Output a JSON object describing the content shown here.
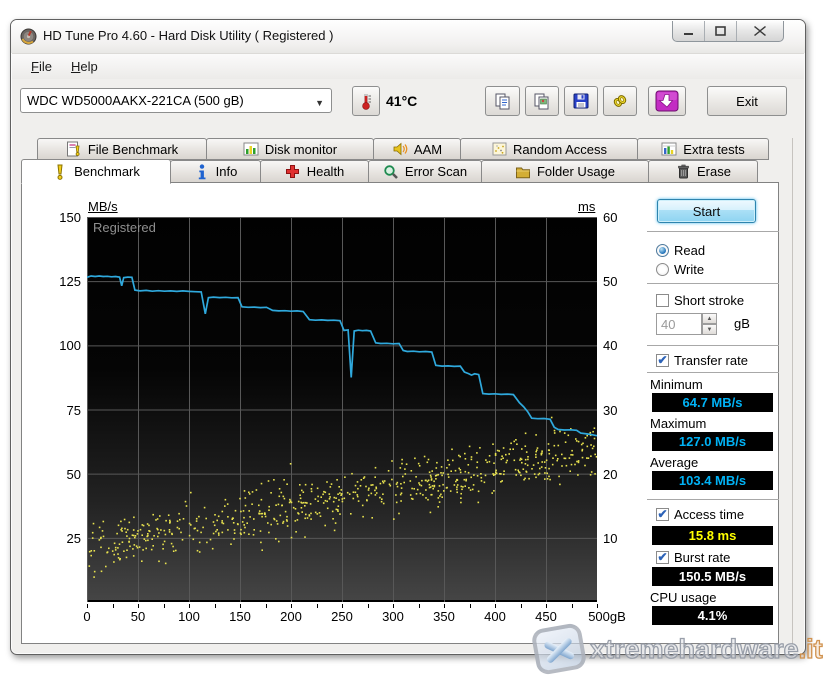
{
  "window": {
    "title": "HD Tune Pro 4.60 - Hard Disk Utility (  Registered )"
  },
  "menu": {
    "items": [
      "File",
      "Help"
    ]
  },
  "toolbar": {
    "drive_selector": {
      "value": "WDC WD5000AAKX-221CA    (500 gB)"
    },
    "temperature": "41°C",
    "buttons": [
      {
        "name": "copy-text"
      },
      {
        "name": "copy-image"
      },
      {
        "name": "save"
      },
      {
        "name": "tools"
      },
      {
        "name": "download"
      }
    ],
    "exit_label": "Exit"
  },
  "tabs": {
    "row1": [
      {
        "label": "File Benchmark",
        "icon": "file-benchmark",
        "selected": false
      },
      {
        "label": "Disk monitor",
        "icon": "disk-monitor",
        "selected": false
      },
      {
        "label": "AAM",
        "icon": "aam",
        "selected": false
      },
      {
        "label": "Random Access",
        "icon": "random-access",
        "selected": false
      },
      {
        "label": "Extra tests",
        "icon": "extra-tests",
        "selected": false
      }
    ],
    "row2": [
      {
        "label": "Benchmark",
        "icon": "benchmark",
        "selected": true
      },
      {
        "label": "Info",
        "icon": "info",
        "selected": false
      },
      {
        "label": "Health",
        "icon": "health",
        "selected": false
      },
      {
        "label": "Error Scan",
        "icon": "error-scan",
        "selected": false
      },
      {
        "label": "Folder Usage",
        "icon": "folder-usage",
        "selected": false
      },
      {
        "label": "Erase",
        "icon": "erase",
        "selected": false
      }
    ]
  },
  "chart_data": {
    "type": "line+scatter",
    "overlay_text": "Registered",
    "x_axis": {
      "min": 0,
      "max": 500,
      "tick_step": 50,
      "minor_tick_step": 25,
      "unit_suffix": "gB"
    },
    "left_axis": {
      "label": "MB/s",
      "min": 0,
      "max": 150,
      "tick_step": 25
    },
    "right_axis": {
      "label": "ms",
      "min": 0,
      "max": 60,
      "tick_step": 10
    },
    "grid_color": "#585858",
    "series": [
      {
        "name": "Transfer rate",
        "type": "line",
        "axis": "left",
        "unit": "MB/s",
        "color": "#2fa9dd",
        "points": [
          [
            0,
            126.5
          ],
          [
            4,
            127
          ],
          [
            8,
            126.8
          ],
          [
            12,
            127
          ],
          [
            16,
            126.8
          ],
          [
            20,
            126.9
          ],
          [
            24,
            126.7
          ],
          [
            28,
            126.8
          ],
          [
            32,
            126.6
          ],
          [
            34,
            123.2
          ],
          [
            36,
            126.4
          ],
          [
            40,
            126.6
          ],
          [
            44,
            126.5
          ],
          [
            47,
            121.5
          ],
          [
            52,
            121.2
          ],
          [
            58,
            121.4
          ],
          [
            64,
            121.1
          ],
          [
            70,
            121.3
          ],
          [
            76,
            121.1
          ],
          [
            82,
            121.2
          ],
          [
            88,
            121.0
          ],
          [
            94,
            121.2
          ],
          [
            100,
            121.0
          ],
          [
            106,
            120.9
          ],
          [
            112,
            120.8
          ],
          [
            116,
            112.3
          ],
          [
            119,
            118.6
          ],
          [
            124,
            118.8
          ],
          [
            130,
            118.6
          ],
          [
            136,
            118.7
          ],
          [
            142,
            118.5
          ],
          [
            148,
            118.6
          ],
          [
            152,
            115.0
          ],
          [
            158,
            114.8
          ],
          [
            164,
            114.9
          ],
          [
            170,
            114.7
          ],
          [
            176,
            114.8
          ],
          [
            182,
            113.6
          ],
          [
            188,
            113.4
          ],
          [
            194,
            113.5
          ],
          [
            200,
            113.3
          ],
          [
            206,
            113.4
          ],
          [
            212,
            113.2
          ],
          [
            218,
            110.0
          ],
          [
            224,
            109.8
          ],
          [
            230,
            109.9
          ],
          [
            236,
            109.7
          ],
          [
            242,
            109.8
          ],
          [
            248,
            109.6
          ],
          [
            252,
            105.8
          ],
          [
            256,
            106.0
          ],
          [
            259,
            87.5
          ],
          [
            262,
            105.6
          ],
          [
            266,
            105.9
          ],
          [
            270,
            105.7
          ],
          [
            274,
            105.8
          ],
          [
            278,
            105.6
          ],
          [
            283,
            101.0
          ],
          [
            288,
            100.7
          ],
          [
            294,
            100.8
          ],
          [
            300,
            100.6
          ],
          [
            306,
            100.7
          ],
          [
            310,
            98.0
          ],
          [
            314,
            97.6
          ],
          [
            320,
            97.7
          ],
          [
            326,
            97.5
          ],
          [
            332,
            97.6
          ],
          [
            338,
            97.4
          ],
          [
            342,
            92.2
          ],
          [
            348,
            91.9
          ],
          [
            354,
            92.0
          ],
          [
            360,
            91.8
          ],
          [
            366,
            91.9
          ],
          [
            370,
            89.6
          ],
          [
            374,
            89.0
          ],
          [
            377,
            88.4
          ],
          [
            380,
            88.9
          ],
          [
            384,
            88.6
          ],
          [
            388,
            81.2
          ],
          [
            394,
            81.0
          ],
          [
            400,
            81.1
          ],
          [
            406,
            80.9
          ],
          [
            412,
            81.0
          ],
          [
            418,
            80.8
          ],
          [
            424,
            77.6
          ],
          [
            428,
            76.1
          ],
          [
            432,
            74.2
          ],
          [
            436,
            71.6
          ],
          [
            442,
            71.4
          ],
          [
            448,
            71.5
          ],
          [
            454,
            71.2
          ],
          [
            458,
            68.1
          ],
          [
            462,
            67.2
          ],
          [
            468,
            67.0
          ],
          [
            474,
            67.1
          ],
          [
            480,
            66.9
          ],
          [
            484,
            65.8
          ],
          [
            490,
            65.5
          ],
          [
            495,
            65.2
          ],
          [
            500,
            64.8
          ]
        ]
      },
      {
        "name": "Access time",
        "type": "scatter",
        "axis": "right",
        "unit": "ms",
        "color": "#e9e34f",
        "generator": {
          "seed": 20110417,
          "count": 700,
          "trend_start_ms": 8,
          "trend_end_ms": 24,
          "spread_ms": 6,
          "min_ms": 2.5,
          "max_ms": 29.5
        }
      }
    ]
  },
  "panel": {
    "start_label": "Start",
    "mode": {
      "read_label": "Read",
      "write_label": "Write",
      "selected": "Read"
    },
    "short_stroke": {
      "label": "Short stroke",
      "checked": false,
      "value": "40",
      "unit": "gB"
    },
    "transfer_rate": {
      "label": "Transfer rate",
      "checked": true,
      "minimum_label": "Minimum",
      "minimum": "64.7 MB/s",
      "maximum_label": "Maximum",
      "maximum": "127.0 MB/s",
      "average_label": "Average",
      "average": "103.4 MB/s",
      "value_color": "#00b2f5"
    },
    "access_time": {
      "label": "Access time",
      "checked": true,
      "value": "15.8 ms",
      "value_color": "#ffff00"
    },
    "burst_rate": {
      "label": "Burst rate",
      "checked": true,
      "value": "150.5 MB/s",
      "value_color": "#ffffff"
    },
    "cpu_usage": {
      "label": "CPU usage",
      "value": "4.1%",
      "value_color": "#ffffff"
    }
  },
  "watermark": {
    "text_main": "xtremehardware",
    "text_suffix": ".it"
  }
}
